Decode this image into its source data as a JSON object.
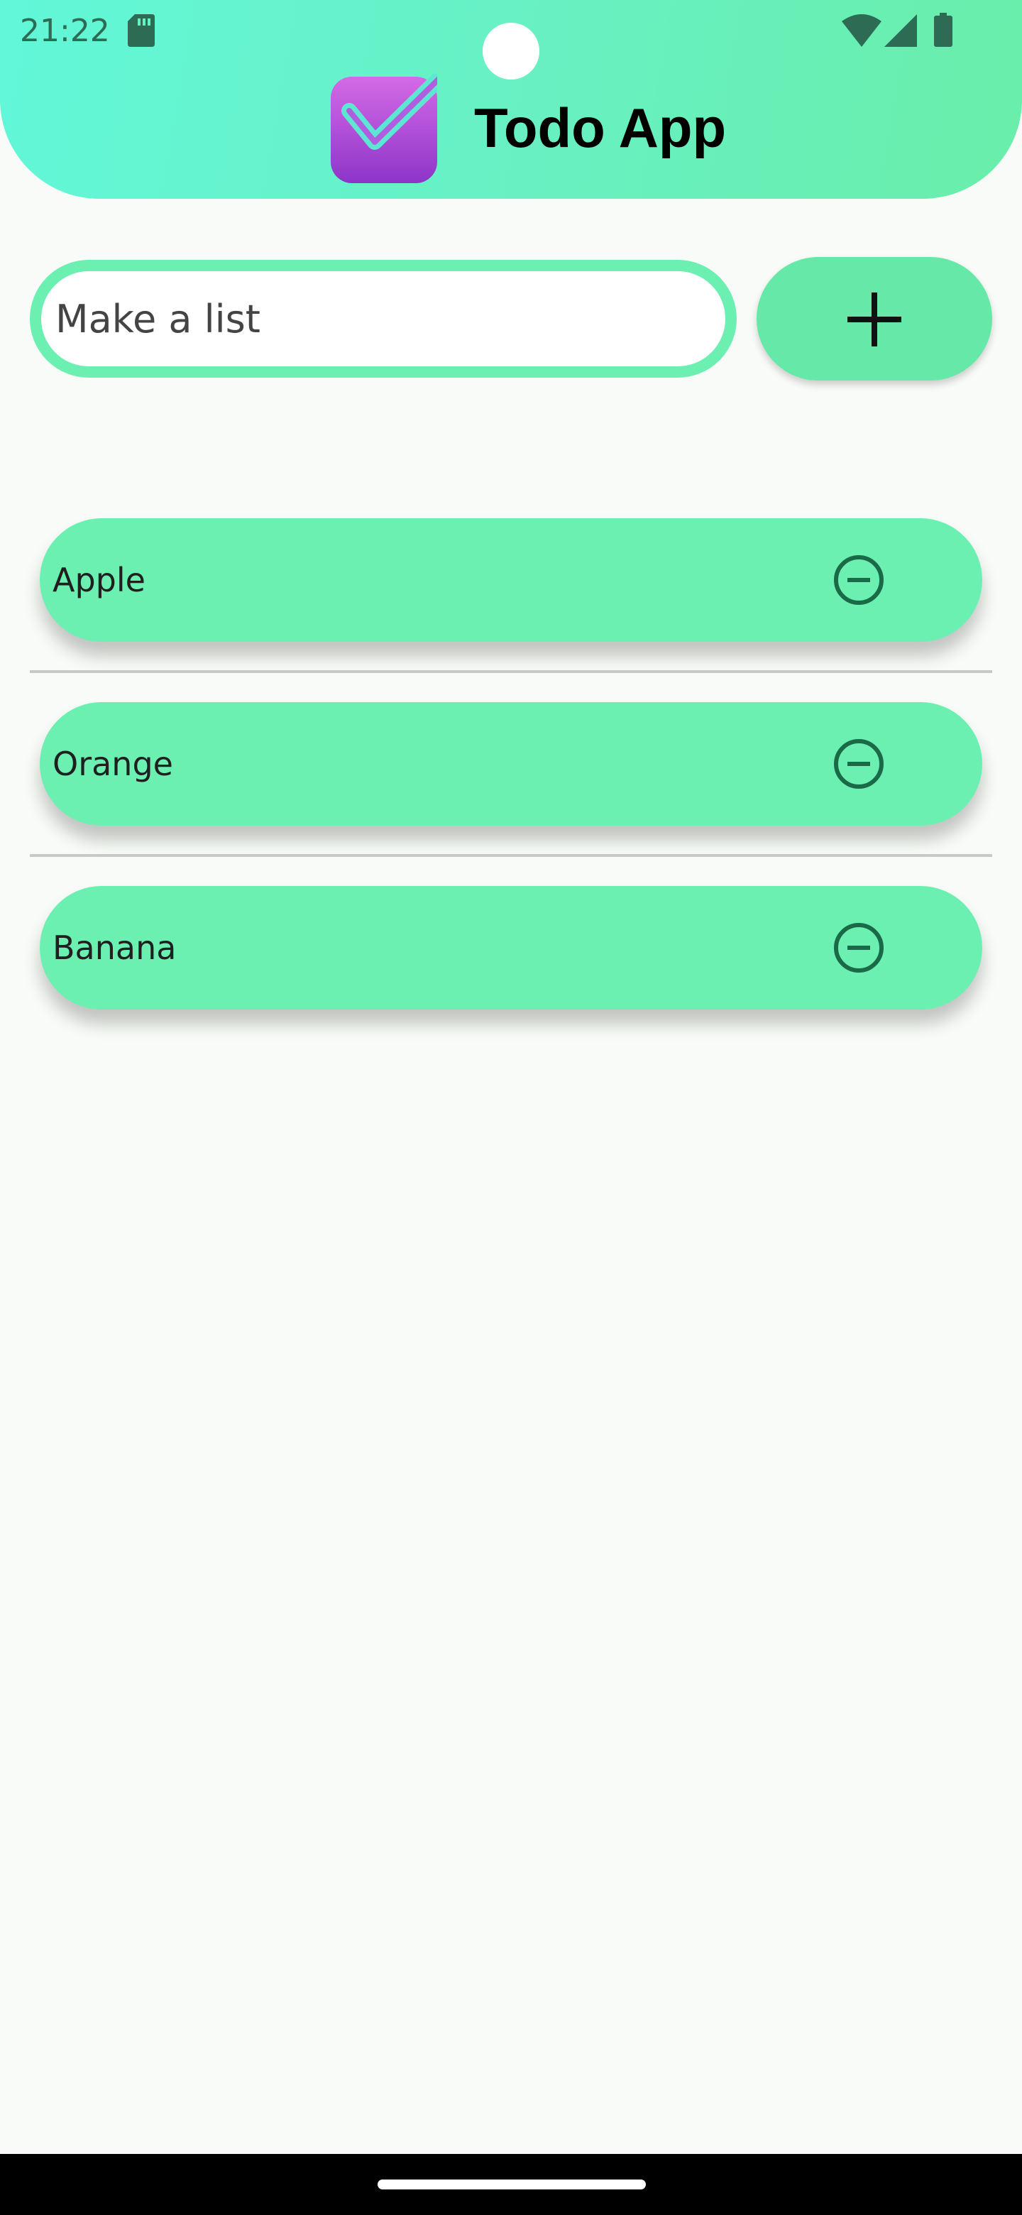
{
  "status_bar": {
    "time": "21:22",
    "icons": [
      "sd-card-icon",
      "wifi-icon",
      "cellular-signal-icon",
      "battery-icon"
    ]
  },
  "header": {
    "title": "Todo App",
    "logo_icon": "checkmark-app-icon"
  },
  "input": {
    "placeholder": "Make a list",
    "value": ""
  },
  "add_button": {
    "icon": "plus-icon"
  },
  "todos": [
    {
      "label": "Apple",
      "action_icon": "remove-circle-icon"
    },
    {
      "label": "Orange",
      "action_icon": "remove-circle-icon"
    },
    {
      "label": "Banana",
      "action_icon": "remove-circle-icon"
    }
  ],
  "colors": {
    "header_gradient_start": "#62f7d9",
    "header_gradient_end": "#69eeaa",
    "accent": "#6bf0b1",
    "icon_dark": "#1b6a47",
    "logo_purple": "#a84bdc",
    "background": "#f8fbf7"
  }
}
